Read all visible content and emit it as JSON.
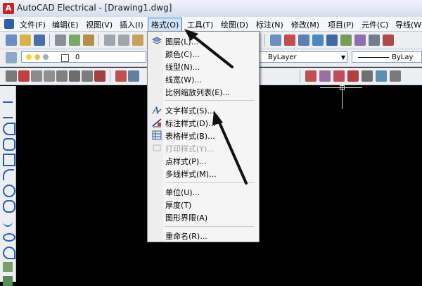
{
  "window": {
    "title": "AutoCAD Electrical - [Drawing1.dwg]",
    "app_icon": "A"
  },
  "menubar": {
    "items": [
      {
        "label": "文件(F)"
      },
      {
        "label": "编辑(E)"
      },
      {
        "label": "视图(V)"
      },
      {
        "label": "插入(I)"
      },
      {
        "label": "格式(O)"
      },
      {
        "label": "工具(T)"
      },
      {
        "label": "绘图(D)"
      },
      {
        "label": "标注(N)"
      },
      {
        "label": "修改(M)"
      },
      {
        "label": "项目(P)"
      },
      {
        "label": "元件(C)"
      },
      {
        "label": "导线(W"
      }
    ]
  },
  "layer_toolbar": {
    "layer_value": "0",
    "color_value": "ByLayer",
    "linetype_value": "ByLay"
  },
  "format_menu": {
    "items": [
      {
        "label": "图层(L)...",
        "icon": "layers-icon",
        "enabled": true
      },
      {
        "label": "颜色(C)...",
        "icon": "",
        "enabled": true
      },
      {
        "label": "线型(N)...",
        "icon": "",
        "enabled": true
      },
      {
        "label": "线宽(W)...",
        "icon": "",
        "enabled": true
      },
      {
        "label": "比例缩放列表(E)...",
        "icon": "",
        "enabled": true
      },
      {
        "label": "文字样式(S)...",
        "icon": "text-style-icon",
        "enabled": true
      },
      {
        "label": "标注样式(D)...",
        "icon": "dimension-style-icon",
        "enabled": true
      },
      {
        "label": "表格样式(B)...",
        "icon": "table-style-icon",
        "enabled": true
      },
      {
        "label": "打印样式(Y)...",
        "icon": "",
        "enabled": false
      },
      {
        "label": "点样式(P)...",
        "icon": "",
        "enabled": true
      },
      {
        "label": "多线样式(M)...",
        "icon": "",
        "enabled": true
      },
      {
        "label": "单位(U)...",
        "icon": "",
        "enabled": true
      },
      {
        "label": "厚度(T)",
        "icon": "",
        "enabled": true
      },
      {
        "label": "图形界限(A)",
        "icon": "",
        "enabled": true
      },
      {
        "label": "重命名(R)...",
        "icon": "",
        "enabled": true
      }
    ]
  },
  "colors": {
    "accent": "#3a75c4",
    "menu_highlight": "#cfe3fa",
    "canvas": "#000000",
    "arrow": "#111111"
  }
}
